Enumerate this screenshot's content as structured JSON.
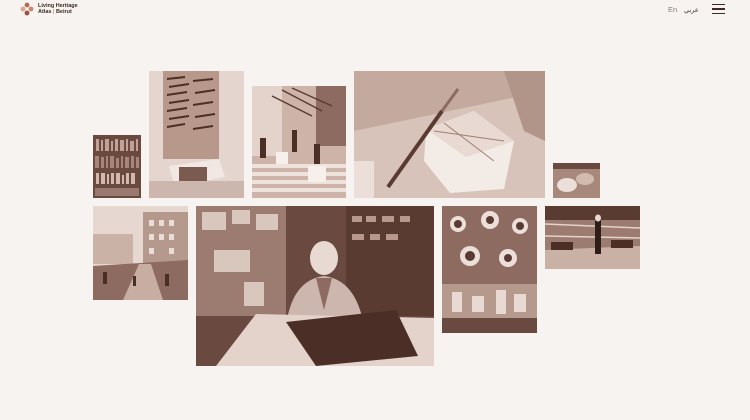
{
  "header": {
    "logo_line1": "Living Heritage",
    "logo_line2a": "Atlas",
    "logo_sep": "|",
    "logo_line2b": "Beirut",
    "lang_en": "En",
    "lang_ar": "عربي",
    "menu_icon": "hamburger-menu-icon"
  },
  "theme": {
    "background": "#f7f3f1",
    "sepia_dark": "#4b2f27",
    "sepia_mid": "#9c7c70",
    "sepia_light": "#dccbc3"
  },
  "gallery": {
    "tiles": [
      {
        "subject": "bookshelf"
      },
      {
        "subject": "tool wall with sewing machine"
      },
      {
        "subject": "market stairs"
      },
      {
        "subject": "chisel and wood box"
      },
      {
        "subject": "small craft close-up"
      },
      {
        "subject": "city street"
      },
      {
        "subject": "craftsman at workbench"
      },
      {
        "subject": "hanging copperware"
      },
      {
        "subject": "workshop interior"
      }
    ]
  }
}
